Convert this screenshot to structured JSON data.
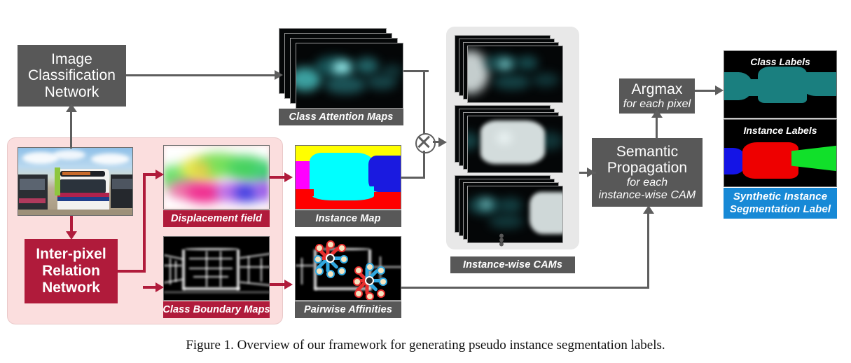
{
  "figure": {
    "caption": "Figure 1.  Overview of our framework for generating pseudo instance segmentation labels."
  },
  "blocks": {
    "image_classification_network": {
      "line1": "Image",
      "line2": "Classification",
      "line3": "Network"
    },
    "inter_pixel_relation_network": {
      "line1": "Inter-pixel",
      "line2": "Relation",
      "line3": "Network"
    },
    "argmax": {
      "title": "Argmax",
      "subtitle": "for each pixel"
    },
    "semantic_propagation": {
      "line1": "Semantic",
      "line2": "Propagation",
      "sub1": "for each",
      "sub2": "instance-wise CAM"
    }
  },
  "plates": {
    "class_attention_maps": "Class Attention Maps",
    "displacement_field": "Displacement field",
    "instance_map": "Instance Map",
    "class_boundary_maps": "Class Boundary Maps",
    "pairwise_affinities": "Pairwise Affinities",
    "instance_wise_cams": "Instance-wise CAMs",
    "class_labels": "Class Labels",
    "instance_labels": "Instance Labels",
    "synthetic_label_line1": "Synthetic Instance",
    "synthetic_label_line2": "Segmentation Label"
  },
  "symbols": {
    "tensor_product": "⊗",
    "vertical_ellipsis": "⋮"
  },
  "colors": {
    "process_box": "#585858",
    "red_box": "#b01b3b",
    "pink_panel": "#fbdede",
    "blue_caption": "#1789d6",
    "connector": "#5e5e5e",
    "class_label_teal": "#1a7f7f",
    "instance_blue": "#1414e6",
    "instance_red": "#ee0000",
    "instance_green": "#11e02a",
    "cam_cyan": "#6fe3e3"
  }
}
